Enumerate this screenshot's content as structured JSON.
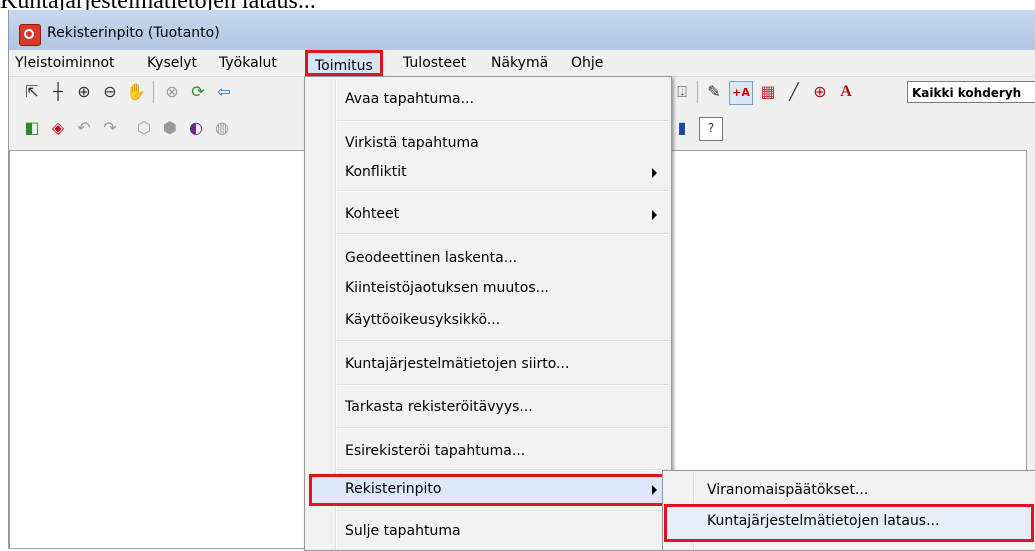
{
  "caption": "Kuntajärjestelmätietojen lataus...",
  "window": {
    "title": "Rekisterinpito (Tuotanto)"
  },
  "menubar": {
    "items": [
      "Yleistoiminnot",
      "Kyselyt",
      "Työkalut",
      "Toimitus",
      "Tulosteet",
      "Näkymä",
      "Ohje"
    ],
    "active": "Toimitus"
  },
  "toolbar": {
    "combo_value": "Kaikki kohderyh",
    "icons_row1": [
      "pointer-icon",
      "crosshair-icon",
      "zoom-in-icon",
      "zoom-out-icon",
      "pan-hand-icon",
      "cancel-icon",
      "refresh-icon",
      "back-arrow-icon",
      "pin-icon",
      "tool-icon",
      "layer-add-icon",
      "fill-icon",
      "line-icon",
      "target-icon",
      "text-icon"
    ],
    "icons_row2": [
      "cube-green-icon",
      "cube-red-icon",
      "undo-icon",
      "redo-icon",
      "shape1-icon",
      "shape2-icon",
      "shape3-icon",
      "shape4-icon",
      "panel-icon",
      "help-icon"
    ]
  },
  "dropdown": {
    "items": [
      {
        "label": "Avaa tapahtuma..."
      },
      {
        "label": "Virkistä tapahtuma"
      },
      {
        "label": "Konfliktit",
        "submenu": true
      },
      {
        "label": "Kohteet",
        "submenu": true
      },
      {
        "label": "Geodeettinen laskenta..."
      },
      {
        "label": "Kiinteistöjaotuksen muutos..."
      },
      {
        "label": "Käyttöoikeusyksikkö..."
      },
      {
        "label": "Kuntajärjestelmätietojen siirto..."
      },
      {
        "label": "Tarkasta rekisteröitävyys..."
      },
      {
        "label": "Esirekisteröi tapahtuma..."
      },
      {
        "label": "Rekisterinpito",
        "submenu": true,
        "highlighted": true
      },
      {
        "label": "Sulje tapahtuma"
      }
    ]
  },
  "submenu": {
    "items": [
      {
        "label": "Viranomaispäätökset..."
      },
      {
        "label": "Kuntajärjestelmätietojen lataus...",
        "highlighted": true
      }
    ]
  },
  "colors": {
    "highlight_border": "#e0141c",
    "menu_bg": "#f2f2f2",
    "titlebar": "#b9cce6"
  }
}
